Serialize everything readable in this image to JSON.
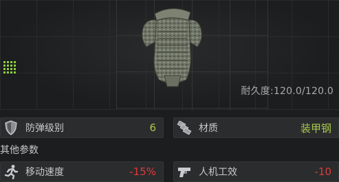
{
  "item": {
    "durability_label": "耐久度:",
    "durability_value": "120.0/120.0",
    "grid_icon": "grid-size-icon"
  },
  "stats": {
    "armor_class": {
      "label": "防弹级别",
      "value": "6",
      "icon": "shield-icon"
    },
    "material": {
      "label": "材质",
      "value": "装甲钢",
      "icon": "armor-plates-icon"
    }
  },
  "other_params": {
    "title": "其他参数",
    "move_speed": {
      "label": "移动速度",
      "value": "-15%",
      "icon": "running-man-icon"
    },
    "ergonomics": {
      "label": "人机工效",
      "value": "-10",
      "icon": "pistol-icon"
    }
  },
  "colors": {
    "positive": "#a9c94f",
    "negative": "#e03a3a",
    "grid_badge": "#8fcf3d"
  }
}
